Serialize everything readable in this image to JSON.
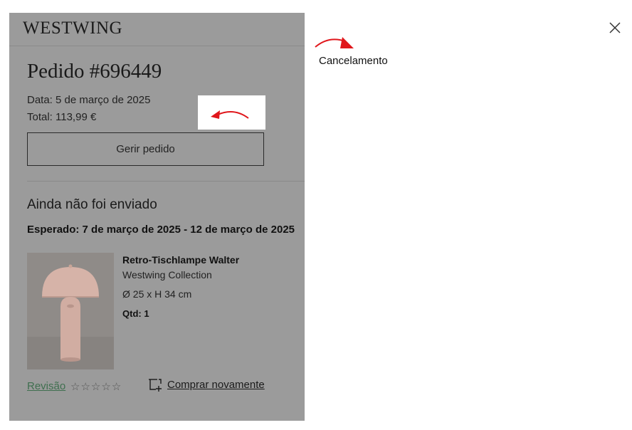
{
  "header": {
    "logo": "WESTWING"
  },
  "order": {
    "title": "Pedido #696449",
    "date": "Data: 5 de março de 2025",
    "total": "Total: 113,99 €",
    "manage_button": "Gerir pedido"
  },
  "shipment": {
    "status": "Ainda não foi enviado",
    "expected": "Esperado: 7 de março de 2025 - 12 de março de 2025"
  },
  "product": {
    "name": "Retro-Tischlampe Walter",
    "brand": "Westwing Collection",
    "dimensions": "Ø 25 x H 34 cm",
    "quantity": "Qtd: 1",
    "image_icon": "table-lamp",
    "rating": {
      "stars": 0,
      "max": 5
    }
  },
  "actions": {
    "review": "Revisão",
    "buy_again": "Comprar novamente",
    "buy_again_icon": "add-to-cart-icon"
  },
  "annotation": {
    "label": "Cancelamento",
    "arrow_color": "#e0161b"
  },
  "close_icon": "close-icon",
  "colors": {
    "overlay": "#9b9b9b",
    "review_link": "#3f6f4f",
    "lamp": "#d6b3a8"
  }
}
